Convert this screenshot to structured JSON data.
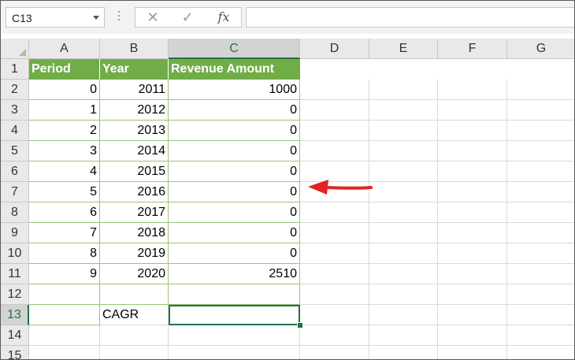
{
  "name_box": {
    "value": "C13"
  },
  "formula_bar": {
    "cancel_glyph": "✕",
    "enter_glyph": "✓",
    "fx_label": "fx",
    "formula": ""
  },
  "columns": [
    "A",
    "B",
    "C",
    "D",
    "E",
    "F",
    "G"
  ],
  "selected_column": "C",
  "rows": [
    "1",
    "2",
    "3",
    "4",
    "5",
    "6",
    "7",
    "8",
    "9",
    "10",
    "11",
    "12",
    "13",
    "14",
    "15"
  ],
  "selected_row": "13",
  "table": {
    "headers": [
      "Period",
      "Year",
      "Revenue Amount"
    ],
    "rows": [
      [
        "0",
        "2011",
        "1000"
      ],
      [
        "1",
        "2012",
        "0"
      ],
      [
        "2",
        "2013",
        "0"
      ],
      [
        "3",
        "2014",
        "0"
      ],
      [
        "4",
        "2015",
        "0"
      ],
      [
        "5",
        "2016",
        "0"
      ],
      [
        "6",
        "2017",
        "0"
      ],
      [
        "7",
        "2018",
        "0"
      ],
      [
        "8",
        "2019",
        "0"
      ],
      [
        "9",
        "2020",
        "2510"
      ]
    ]
  },
  "cagr": {
    "label": "CAGR",
    "value": ""
  },
  "colors": {
    "header_fill": "#70ad47",
    "selection": "#217346",
    "arrow": "#e02424"
  }
}
